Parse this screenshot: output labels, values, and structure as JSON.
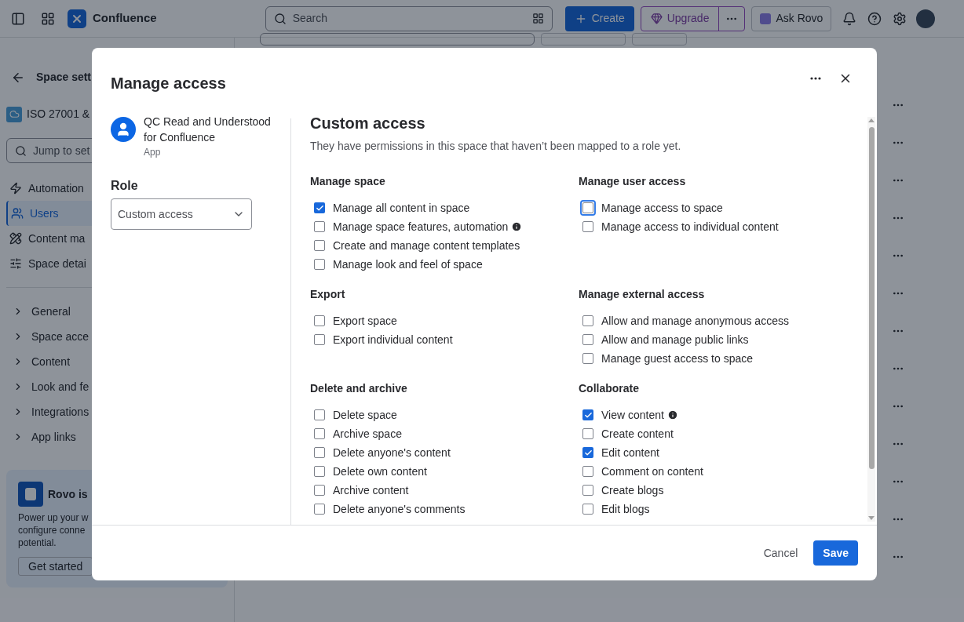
{
  "top_bar": {
    "product": "Confluence",
    "search_placeholder": "Search",
    "create": "Create",
    "upgrade": "Upgrade",
    "ask_rovo": "Ask Rovo"
  },
  "sidebar": {
    "back_title": "Space sett",
    "space_name": "ISO 27001 &",
    "jump_placeholder": "Jump to set",
    "nav": [
      {
        "label": "Automation",
        "selected": false
      },
      {
        "label": "Users",
        "selected": true
      },
      {
        "label": "Content ma",
        "selected": false
      },
      {
        "label": "Space detai",
        "selected": false
      }
    ],
    "groups": [
      "General",
      "Space acce",
      "Content",
      "Look and fe",
      "Integrations",
      "App links"
    ],
    "promo": {
      "title": "Rovo is",
      "lines": [
        "Power up your w",
        "configure conne",
        "potential."
      ],
      "button": "Get started"
    }
  },
  "dialog": {
    "title": "Manage access",
    "app_name": "QC Read and Understood for Confluence",
    "app_type": "App",
    "role_label": "Role",
    "role_value": "Custom access",
    "heading": "Custom access",
    "description": "They have permissions in this space that haven’t been mapped to a role yet.",
    "sections": [
      {
        "title": "Manage space",
        "items": [
          {
            "label": "Manage all content in space",
            "checked": true,
            "info": false,
            "focused": false
          },
          {
            "label": "Manage space features, automation",
            "checked": false,
            "info": true,
            "focused": false
          },
          {
            "label": "Create and manage content templates",
            "checked": false,
            "info": false,
            "focused": false
          },
          {
            "label": "Manage look and feel of space",
            "checked": false,
            "info": false,
            "focused": false
          }
        ]
      },
      {
        "title": "Manage user access",
        "items": [
          {
            "label": "Manage access to space",
            "checked": false,
            "info": false,
            "focused": true
          },
          {
            "label": "Manage access to individual content",
            "checked": false,
            "info": false,
            "focused": false
          }
        ]
      },
      {
        "title": "Export",
        "items": [
          {
            "label": "Export space",
            "checked": false,
            "info": false,
            "focused": false
          },
          {
            "label": "Export individual content",
            "checked": false,
            "info": false,
            "focused": false
          }
        ]
      },
      {
        "title": "Manage external access",
        "items": [
          {
            "label": "Allow and manage anonymous access",
            "checked": false,
            "info": false,
            "focused": false
          },
          {
            "label": "Allow and manage public links",
            "checked": false,
            "info": false,
            "focused": false
          },
          {
            "label": "Manage guest access to space",
            "checked": false,
            "info": false,
            "focused": false
          }
        ]
      },
      {
        "title": "Delete and archive",
        "items": [
          {
            "label": "Delete space",
            "checked": false,
            "info": false,
            "focused": false
          },
          {
            "label": "Archive space",
            "checked": false,
            "info": false,
            "focused": false
          },
          {
            "label": "Delete anyone's content",
            "checked": false,
            "info": false,
            "focused": false
          },
          {
            "label": "Delete own content",
            "checked": false,
            "info": false,
            "focused": false
          },
          {
            "label": "Archive content",
            "checked": false,
            "info": false,
            "focused": false
          },
          {
            "label": "Delete anyone's comments",
            "checked": false,
            "info": false,
            "focused": false
          }
        ]
      },
      {
        "title": "Collaborate",
        "items": [
          {
            "label": "View content",
            "checked": true,
            "info": true,
            "focused": false
          },
          {
            "label": "Create content",
            "checked": false,
            "info": false,
            "focused": false
          },
          {
            "label": "Edit content",
            "checked": true,
            "info": false,
            "focused": false
          },
          {
            "label": "Comment on content",
            "checked": false,
            "info": false,
            "focused": false
          },
          {
            "label": "Create blogs",
            "checked": false,
            "info": false,
            "focused": false
          },
          {
            "label": "Edit blogs",
            "checked": false,
            "info": false,
            "focused": false
          }
        ]
      }
    ],
    "cancel": "Cancel",
    "save": "Save"
  }
}
